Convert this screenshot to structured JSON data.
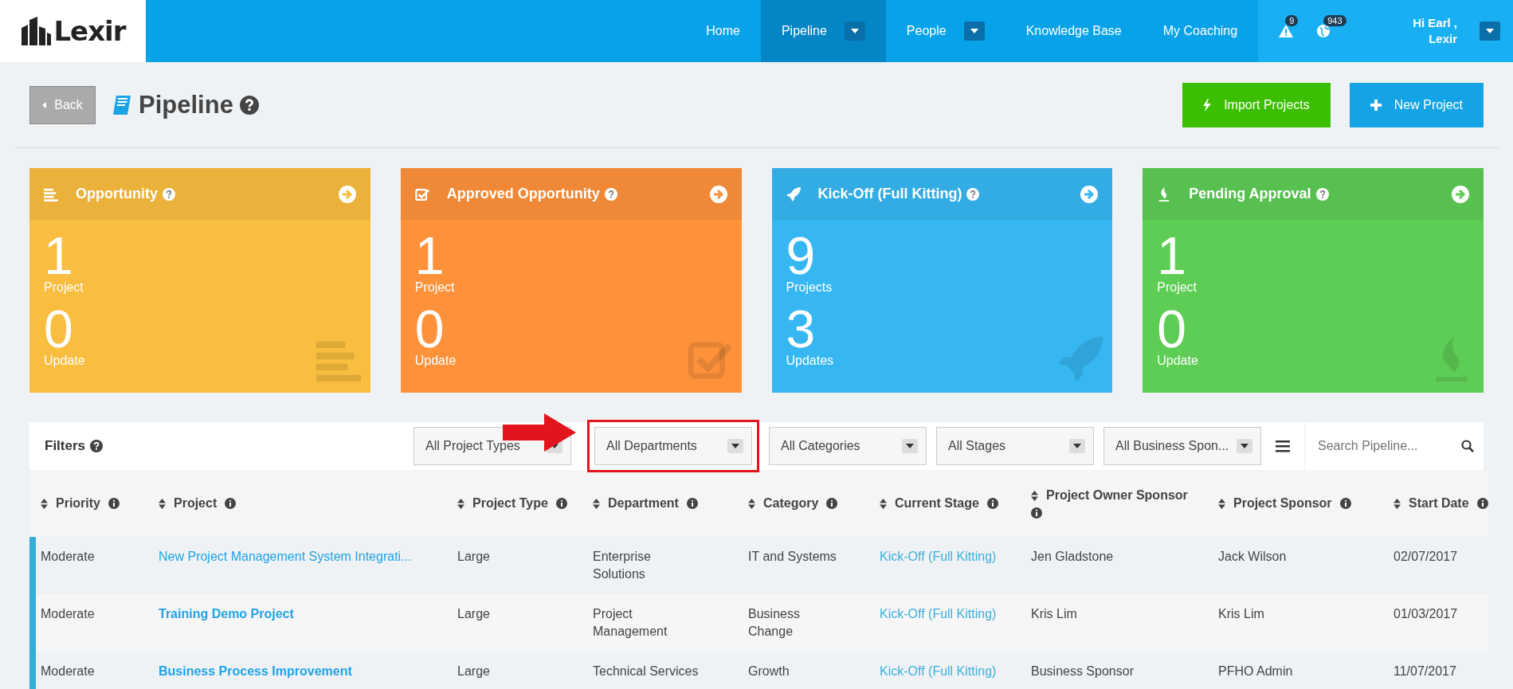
{
  "nav": {
    "logo": "Lexir",
    "items": [
      {
        "label": "Home",
        "selected": false,
        "dropdown": false
      },
      {
        "label": "Pipeline",
        "selected": true,
        "dropdown": true
      },
      {
        "label": "People",
        "selected": false,
        "dropdown": true
      },
      {
        "label": "Knowledge Base",
        "selected": false,
        "dropdown": false
      },
      {
        "label": "My Coaching",
        "selected": false,
        "dropdown": false
      }
    ],
    "alerts_badge": "9",
    "notifications_badge": "943",
    "greeting": "Hi Earl ,",
    "user": "Lexir"
  },
  "header": {
    "back": "Back",
    "title": "Pipeline",
    "buttons": [
      {
        "label": "Import Projects",
        "kind": "import"
      },
      {
        "label": "New Project",
        "kind": "new"
      }
    ]
  },
  "cards": [
    {
      "title": "Opportunity",
      "kind": "list",
      "color": "#f9bd3f",
      "count": "1",
      "count_label": "Project",
      "updates": "0",
      "updates_label": "Update"
    },
    {
      "title": "Approved Opportunity",
      "kind": "check",
      "color": "#fe923b",
      "count": "1",
      "count_label": "Project",
      "updates": "0",
      "updates_label": "Update"
    },
    {
      "title": "Kick-Off (Full Kitting)",
      "kind": "rocket",
      "color": "#36b7f2",
      "count": "9",
      "count_label": "Projects",
      "updates": "3",
      "updates_label": "Updates"
    },
    {
      "title": "Pending Approval",
      "kind": "fire",
      "color": "#5ecd55",
      "count": "1",
      "count_label": "Project",
      "updates": "0",
      "updates_label": "Update"
    }
  ],
  "filters": {
    "label": "Filters",
    "selects": [
      {
        "value": "All Project Types",
        "highlighted": false
      },
      {
        "value": "All Departments",
        "highlighted": true
      },
      {
        "value": "All Categories",
        "highlighted": false
      },
      {
        "value": "All Stages",
        "highlighted": false
      },
      {
        "value": "All Business Spon...",
        "highlighted": false
      }
    ],
    "search": {
      "placeholder": "Search Pipeline..."
    }
  },
  "table": {
    "columns": [
      "Priority",
      "Project",
      "Project Type",
      "Department",
      "Category",
      "Current Stage",
      "Project Owner Sponsor",
      "Project Sponsor",
      "Start Date"
    ],
    "rows": [
      {
        "priority": "Moderate",
        "project": "New Project Management System Integrati...",
        "bold": false,
        "type": "Large",
        "department": "Enterprise Solutions",
        "category": "IT and Systems",
        "stage": "Kick-Off (Full Kitting)",
        "owner": "Jen Gladstone",
        "sponsor": "Jack Wilson",
        "start": "02/07/2017"
      },
      {
        "priority": "Moderate",
        "project": "Training Demo Project",
        "bold": true,
        "type": "Large",
        "department": "Project Management",
        "category": "Business Change",
        "stage": "Kick-Off (Full Kitting)",
        "owner": "Kris Lim",
        "sponsor": "Kris Lim",
        "start": "01/03/2017"
      },
      {
        "priority": "Moderate",
        "project": "Business Process Improvement",
        "bold": true,
        "type": "Large",
        "department": "Technical Services",
        "category": "Growth",
        "stage": "Kick-Off (Full Kitting)",
        "owner": "Business Sponsor",
        "sponsor": "PFHO Admin",
        "start": "11/07/2017"
      }
    ]
  }
}
